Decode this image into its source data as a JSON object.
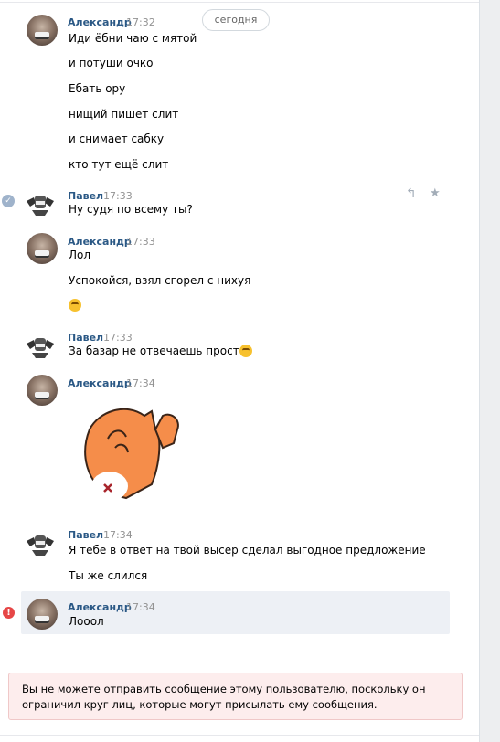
{
  "date_pill": "сегодня",
  "icons": {
    "sent_mark": "check-icon",
    "error_mark": "error-icon",
    "reply": "reply-icon",
    "favorite": "star-icon"
  },
  "colors": {
    "name": "#2a5885",
    "time": "#939393",
    "error": "#e64646",
    "notice_bg": "#fdeded"
  },
  "groups": [
    {
      "author": "Александр",
      "time": "17:32",
      "messages": [
        "Иди ёбни чаю с мятой",
        "и потуши очко",
        "Ебать ору",
        "нищий пишет слит",
        "и снимает сабку",
        "кто тут ещё слит"
      ]
    },
    {
      "author": "Павел",
      "time": "17:33",
      "messages": [
        "Ну судя по всему ты?"
      ]
    },
    {
      "author": "Александр",
      "time": "17:33",
      "messages": [
        "Лол",
        "Успокойся, взял сгорел с нихуя"
      ],
      "emoji": "smile-emoji"
    },
    {
      "author": "Павел",
      "time": "17:33",
      "messages": [
        "За базар не отвечаешь прост"
      ],
      "emoji": "rofl-emoji"
    },
    {
      "author": "Александр",
      "time": "17:34",
      "sticker": "cat-sticker"
    },
    {
      "author": "Павел",
      "time": "17:34",
      "messages": [
        "Я тебе в ответ на твой высер сделал выгодное предложение",
        "Ты же слился"
      ]
    },
    {
      "author": "Александр",
      "time": "17:34",
      "messages": [
        "Лооол"
      ]
    }
  ],
  "notice": "Вы не можете отправить сообщение этому пользователю, поскольку он ограничил круг лиц, которые могут присылать ему сообщения."
}
